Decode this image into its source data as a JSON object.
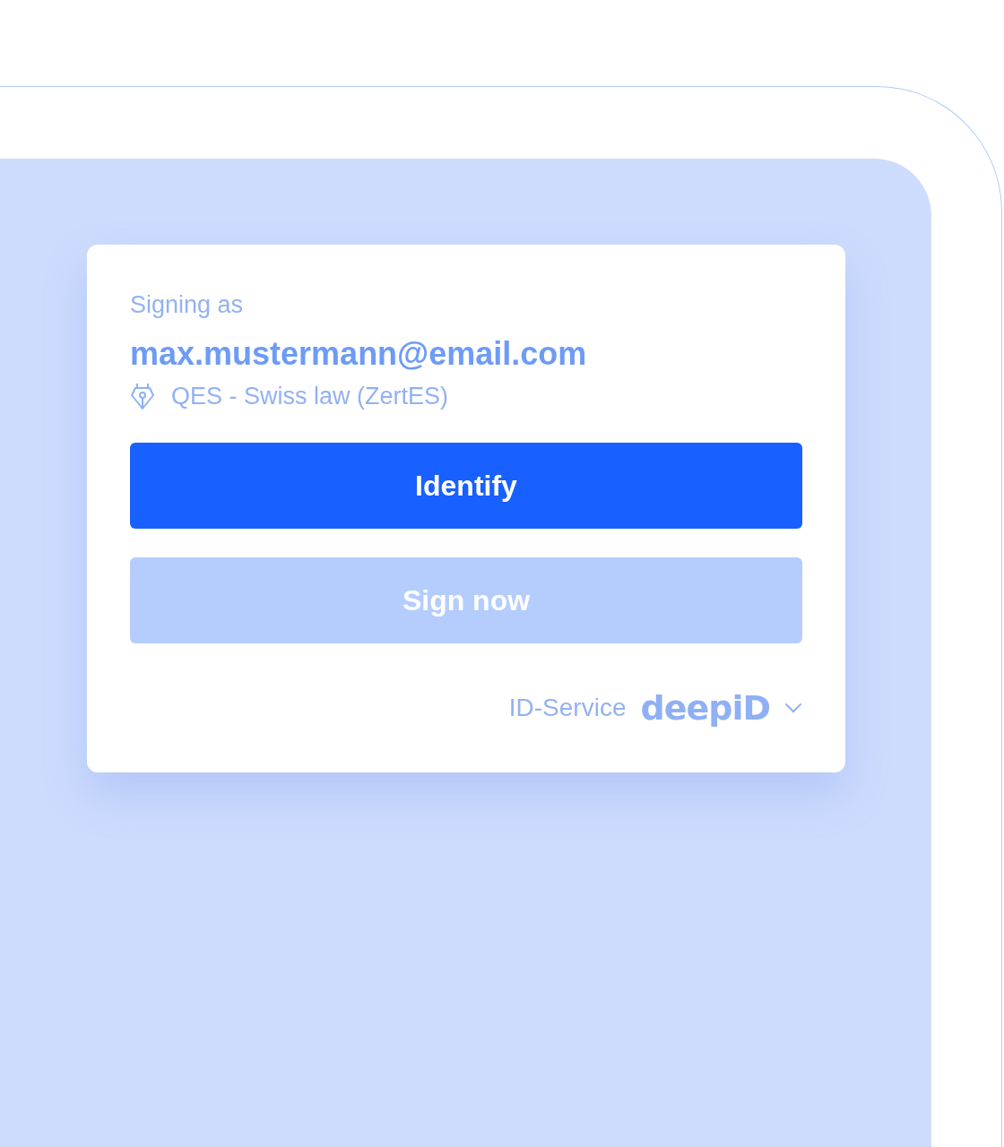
{
  "signing_label": "Signing as",
  "email": "max.mustermann@email.com",
  "signature_type": "QES - Swiss law (ZertES)",
  "buttons": [
    {
      "label": "Identify",
      "disabled": false
    },
    {
      "label": "Sign now",
      "disabled": true
    }
  ],
  "id_service": {
    "label": "ID-Service",
    "provider": "deepiD"
  }
}
